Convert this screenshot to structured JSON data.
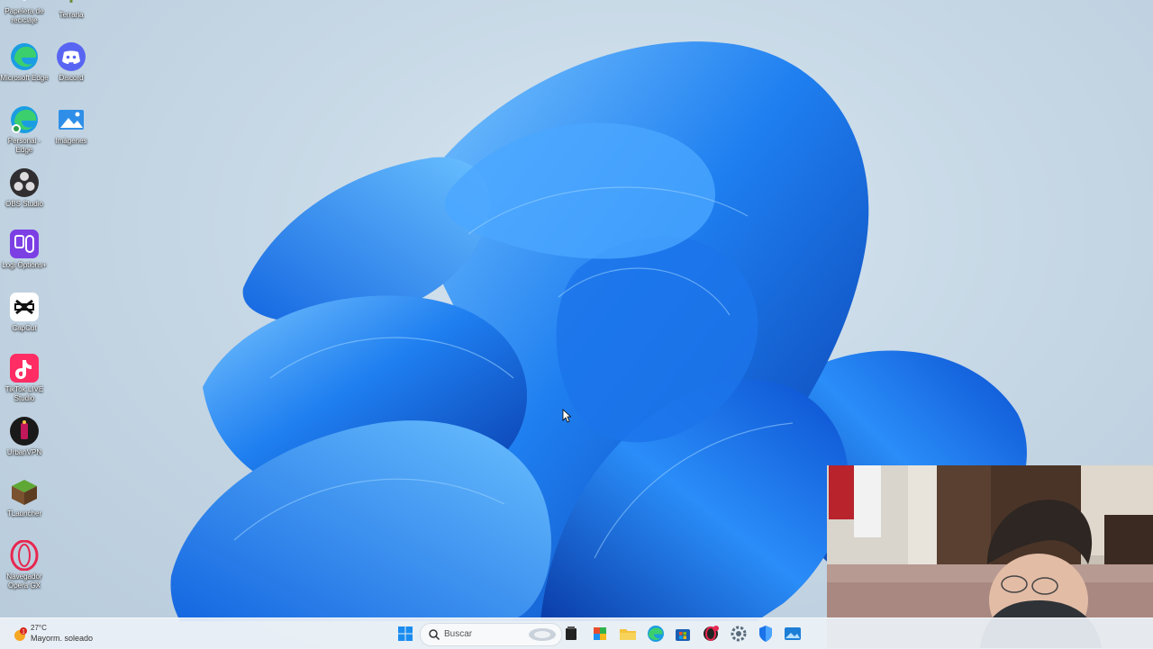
{
  "desktop": {
    "icons": [
      {
        "label": "Papelera de reciclaje",
        "icon": "recycle-bin-icon"
      },
      {
        "label": "Terraria",
        "icon": "terraria-icon"
      },
      {
        "label": "Microsoft Edge",
        "icon": "edge-icon"
      },
      {
        "label": "Discord",
        "icon": "discord-icon"
      },
      {
        "label": "Personal - Edge",
        "icon": "edge-personal-icon"
      },
      {
        "label": "Imágenes",
        "icon": "pictures-folder-icon"
      },
      {
        "label": "OBS Studio",
        "icon": "obs-icon"
      },
      {
        "label": "Logi Options+",
        "icon": "logi-options-icon"
      },
      {
        "label": "CapCut",
        "icon": "capcut-icon"
      },
      {
        "label": "TikTok LIVE Studio",
        "icon": "tiktok-live-icon"
      },
      {
        "label": "UrbanVPN",
        "icon": "urbanvpn-icon"
      },
      {
        "label": "TLauncher",
        "icon": "tlauncher-icon"
      },
      {
        "label": "Navegador Opera GX",
        "icon": "opera-gx-icon"
      }
    ]
  },
  "taskbar": {
    "weather": {
      "temp": "27°C",
      "condition": "Mayorm. soleado",
      "badge": "1"
    },
    "search": {
      "placeholder": "Buscar"
    },
    "apps": [
      "start-icon",
      "file-manager-icon",
      "copilot-icon",
      "file-explorer-icon",
      "edge-icon",
      "store-icon",
      "opera-gx-icon",
      "settings-icon",
      "defender-icon",
      "photos-icon"
    ]
  },
  "colors": {
    "accent": "#1a6fe0",
    "bloom_dark": "#0a3fb0",
    "bloom_light": "#5fb4ff",
    "desktop_bg": "#c6d7e5"
  }
}
